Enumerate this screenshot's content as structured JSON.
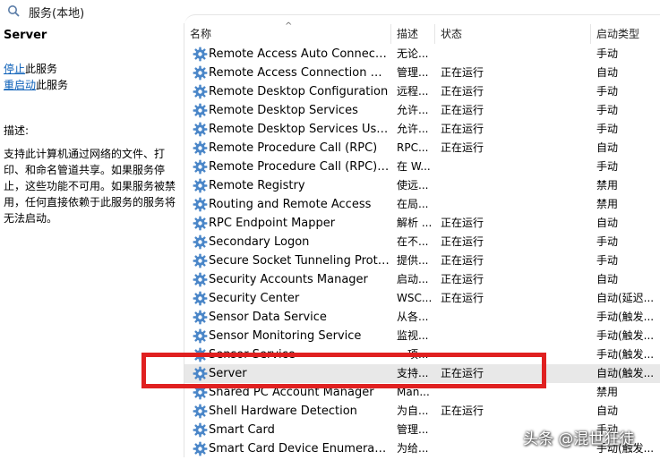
{
  "window": {
    "title": "服务(本地)"
  },
  "left_panel": {
    "service_title": "Server",
    "stop_link": "停止",
    "stop_suffix": "此服务",
    "restart_link": "重启动",
    "restart_suffix": "此服务",
    "desc_label": "描述:",
    "description": "支持此计算机通过网络的文件、打印、和命名管道共享。如果服务停止，这些功能不可用。如果服务被禁用，任何直接依赖于此服务的服务将无法启动。"
  },
  "columns": {
    "name": "名称",
    "desc": "描述",
    "status": "状态",
    "startup": "启动类型"
  },
  "services": [
    {
      "name": "Remote Access Auto Connection ...",
      "desc": "无论...",
      "status": "",
      "startup": "手动"
    },
    {
      "name": "Remote Access Connection Man...",
      "desc": "管理...",
      "status": "正在运行",
      "startup": "自动"
    },
    {
      "name": "Remote Desktop Configuration",
      "desc": "远程...",
      "status": "正在运行",
      "startup": "手动"
    },
    {
      "name": "Remote Desktop Services",
      "desc": "允许...",
      "status": "正在运行",
      "startup": "手动"
    },
    {
      "name": "Remote Desktop Services UserM...",
      "desc": "允许...",
      "status": "正在运行",
      "startup": "手动"
    },
    {
      "name": "Remote Procedure Call (RPC)",
      "desc": "RPC...",
      "status": "正在运行",
      "startup": "自动"
    },
    {
      "name": "Remote Procedure Call (RPC) Loc...",
      "desc": "在 W...",
      "status": "",
      "startup": "手动"
    },
    {
      "name": "Remote Registry",
      "desc": "使远...",
      "status": "",
      "startup": "禁用"
    },
    {
      "name": "Routing and Remote Access",
      "desc": "在局...",
      "status": "",
      "startup": "禁用"
    },
    {
      "name": "RPC Endpoint Mapper",
      "desc": "解析 ...",
      "status": "正在运行",
      "startup": "自动"
    },
    {
      "name": "Secondary Logon",
      "desc": "在不...",
      "status": "正在运行",
      "startup": "手动"
    },
    {
      "name": "Secure Socket Tunneling Protoco...",
      "desc": "提供...",
      "status": "正在运行",
      "startup": "手动"
    },
    {
      "name": "Security Accounts Manager",
      "desc": "启动...",
      "status": "正在运行",
      "startup": "自动"
    },
    {
      "name": "Security Center",
      "desc": "WSC...",
      "status": "正在运行",
      "startup": "自动(延迟..."
    },
    {
      "name": "Sensor Data Service",
      "desc": "从各...",
      "status": "",
      "startup": "手动(触发..."
    },
    {
      "name": "Sensor Monitoring Service",
      "desc": "监视...",
      "status": "",
      "startup": "手动(触发..."
    },
    {
      "name": "Sensor Service",
      "desc": "一项...",
      "status": "",
      "startup": "手动(触发..."
    },
    {
      "name": "Server",
      "desc": "支持...",
      "status": "正在运行",
      "startup": "自动(触发..."
    },
    {
      "name": "Shared PC Account Manager",
      "desc": "Man...",
      "status": "",
      "startup": "禁用"
    },
    {
      "name": "Shell Hardware Detection",
      "desc": "为自...",
      "status": "正在运行",
      "startup": "自动"
    },
    {
      "name": "Smart Card",
      "desc": "管理...",
      "status": "",
      "startup": "手动"
    },
    {
      "name": "Smart Card Device Enumeration ...",
      "desc": "为给...",
      "status": "",
      "startup": "手动(触发..."
    }
  ],
  "selected_service": "Server",
  "watermark": "头条 @混世狂徒",
  "colors": {
    "highlight": "#e02020",
    "link": "#0b5fb8",
    "gear": "#4a86c8"
  }
}
